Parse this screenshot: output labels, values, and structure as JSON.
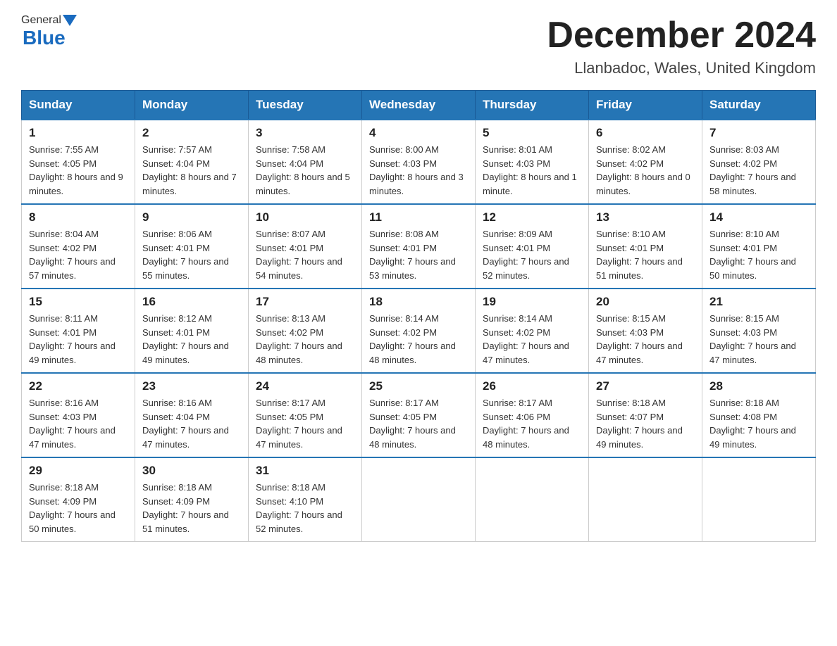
{
  "header": {
    "logo_general": "General",
    "logo_blue": "Blue",
    "month_title": "December 2024",
    "location": "Llanbadoc, Wales, United Kingdom"
  },
  "days_of_week": [
    "Sunday",
    "Monday",
    "Tuesday",
    "Wednesday",
    "Thursday",
    "Friday",
    "Saturday"
  ],
  "weeks": [
    [
      {
        "day": "1",
        "sunrise": "7:55 AM",
        "sunset": "4:05 PM",
        "daylight": "8 hours and 9 minutes."
      },
      {
        "day": "2",
        "sunrise": "7:57 AM",
        "sunset": "4:04 PM",
        "daylight": "8 hours and 7 minutes."
      },
      {
        "day": "3",
        "sunrise": "7:58 AM",
        "sunset": "4:04 PM",
        "daylight": "8 hours and 5 minutes."
      },
      {
        "day": "4",
        "sunrise": "8:00 AM",
        "sunset": "4:03 PM",
        "daylight": "8 hours and 3 minutes."
      },
      {
        "day": "5",
        "sunrise": "8:01 AM",
        "sunset": "4:03 PM",
        "daylight": "8 hours and 1 minute."
      },
      {
        "day": "6",
        "sunrise": "8:02 AM",
        "sunset": "4:02 PM",
        "daylight": "8 hours and 0 minutes."
      },
      {
        "day": "7",
        "sunrise": "8:03 AM",
        "sunset": "4:02 PM",
        "daylight": "7 hours and 58 minutes."
      }
    ],
    [
      {
        "day": "8",
        "sunrise": "8:04 AM",
        "sunset": "4:02 PM",
        "daylight": "7 hours and 57 minutes."
      },
      {
        "day": "9",
        "sunrise": "8:06 AM",
        "sunset": "4:01 PM",
        "daylight": "7 hours and 55 minutes."
      },
      {
        "day": "10",
        "sunrise": "8:07 AM",
        "sunset": "4:01 PM",
        "daylight": "7 hours and 54 minutes."
      },
      {
        "day": "11",
        "sunrise": "8:08 AM",
        "sunset": "4:01 PM",
        "daylight": "7 hours and 53 minutes."
      },
      {
        "day": "12",
        "sunrise": "8:09 AM",
        "sunset": "4:01 PM",
        "daylight": "7 hours and 52 minutes."
      },
      {
        "day": "13",
        "sunrise": "8:10 AM",
        "sunset": "4:01 PM",
        "daylight": "7 hours and 51 minutes."
      },
      {
        "day": "14",
        "sunrise": "8:10 AM",
        "sunset": "4:01 PM",
        "daylight": "7 hours and 50 minutes."
      }
    ],
    [
      {
        "day": "15",
        "sunrise": "8:11 AM",
        "sunset": "4:01 PM",
        "daylight": "7 hours and 49 minutes."
      },
      {
        "day": "16",
        "sunrise": "8:12 AM",
        "sunset": "4:01 PM",
        "daylight": "7 hours and 49 minutes."
      },
      {
        "day": "17",
        "sunrise": "8:13 AM",
        "sunset": "4:02 PM",
        "daylight": "7 hours and 48 minutes."
      },
      {
        "day": "18",
        "sunrise": "8:14 AM",
        "sunset": "4:02 PM",
        "daylight": "7 hours and 48 minutes."
      },
      {
        "day": "19",
        "sunrise": "8:14 AM",
        "sunset": "4:02 PM",
        "daylight": "7 hours and 47 minutes."
      },
      {
        "day": "20",
        "sunrise": "8:15 AM",
        "sunset": "4:03 PM",
        "daylight": "7 hours and 47 minutes."
      },
      {
        "day": "21",
        "sunrise": "8:15 AM",
        "sunset": "4:03 PM",
        "daylight": "7 hours and 47 minutes."
      }
    ],
    [
      {
        "day": "22",
        "sunrise": "8:16 AM",
        "sunset": "4:03 PM",
        "daylight": "7 hours and 47 minutes."
      },
      {
        "day": "23",
        "sunrise": "8:16 AM",
        "sunset": "4:04 PM",
        "daylight": "7 hours and 47 minutes."
      },
      {
        "day": "24",
        "sunrise": "8:17 AM",
        "sunset": "4:05 PM",
        "daylight": "7 hours and 47 minutes."
      },
      {
        "day": "25",
        "sunrise": "8:17 AM",
        "sunset": "4:05 PM",
        "daylight": "7 hours and 48 minutes."
      },
      {
        "day": "26",
        "sunrise": "8:17 AM",
        "sunset": "4:06 PM",
        "daylight": "7 hours and 48 minutes."
      },
      {
        "day": "27",
        "sunrise": "8:18 AM",
        "sunset": "4:07 PM",
        "daylight": "7 hours and 49 minutes."
      },
      {
        "day": "28",
        "sunrise": "8:18 AM",
        "sunset": "4:08 PM",
        "daylight": "7 hours and 49 minutes."
      }
    ],
    [
      {
        "day": "29",
        "sunrise": "8:18 AM",
        "sunset": "4:09 PM",
        "daylight": "7 hours and 50 minutes."
      },
      {
        "day": "30",
        "sunrise": "8:18 AM",
        "sunset": "4:09 PM",
        "daylight": "7 hours and 51 minutes."
      },
      {
        "day": "31",
        "sunrise": "8:18 AM",
        "sunset": "4:10 PM",
        "daylight": "7 hours and 52 minutes."
      },
      null,
      null,
      null,
      null
    ]
  ]
}
